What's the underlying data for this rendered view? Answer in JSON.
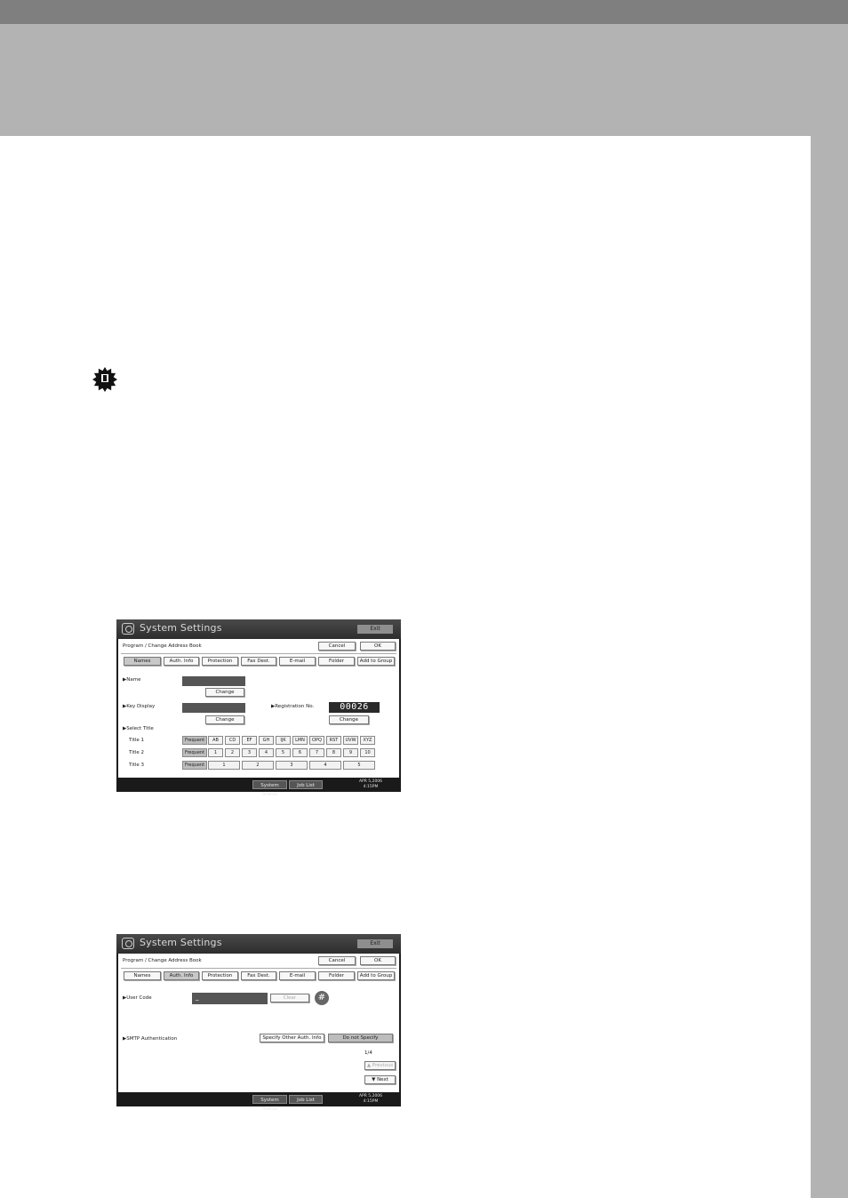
{
  "screens": [
    {
      "title": "System Settings",
      "exit_label": "Exit",
      "breadcrumb": "Program / Change Address Book",
      "cancel_label": "Cancel",
      "ok_label": "OK",
      "tabs": [
        "Names",
        "Auth. Info",
        "Protection",
        "Fax Dest.",
        "E-mail",
        "Folder",
        "Add to Group"
      ],
      "selected_tab": "Names",
      "name_label": "▶Name",
      "name_change": "Change",
      "key_display_label": "▶Key Display",
      "key_display_change": "Change",
      "registration_label": "▶Registration No.",
      "registration_no": "00026",
      "registration_change": "Change",
      "select_title_label": "▶Select Title",
      "title_rows": [
        {
          "label": "Title 1",
          "cells": [
            "Frequent",
            "AB",
            "CD",
            "EF",
            "GH",
            "IJK",
            "LMN",
            "OPQ",
            "RST",
            "UVW",
            "XYZ"
          ]
        },
        {
          "label": "Title 2",
          "cells": [
            "Frequent",
            "1",
            "2",
            "3",
            "4",
            "5",
            "6",
            "7",
            "8",
            "9",
            "10"
          ]
        },
        {
          "label": "Title 3",
          "cells": [
            "Frequent",
            "1",
            "2",
            "3",
            "4",
            "5"
          ]
        }
      ],
      "status_buttons": [
        "System Status",
        "Job List"
      ],
      "date": "APR 5,2006",
      "time": "4:15PM"
    },
    {
      "title": "System Settings",
      "exit_label": "Exit",
      "breadcrumb": "Program / Change Address Book",
      "cancel_label": "Cancel",
      "ok_label": "OK",
      "tabs": [
        "Names",
        "Auth. Info",
        "Protection",
        "Fax Dest.",
        "E-mail",
        "Folder",
        "Add to Group"
      ],
      "selected_tab": "Auth. Info",
      "user_code_label": "▶User Code",
      "user_code_value": "_",
      "clear_label": "Clear",
      "hash_label": "#",
      "smtp_label": "▶SMTP Authentication",
      "smtp_options": [
        "Specify Other Auth. Info",
        "Do not Specify"
      ],
      "smtp_selected": "Do not Specify",
      "page_indicator": "1/4",
      "previous_label": "▲ Previous",
      "next_label": "▼ Next",
      "status_buttons": [
        "System Status",
        "Job List"
      ],
      "date": "APR 5,2006",
      "time": "4:15PM"
    }
  ]
}
